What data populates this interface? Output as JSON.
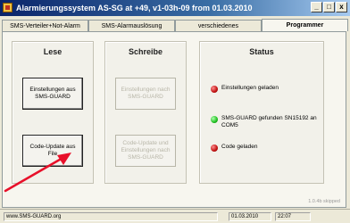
{
  "window": {
    "title": "Alarmierungssystem AS-SG at +49, v1-03h-09 from 01.03.2010",
    "minimize_label": "_",
    "maximize_label": "□",
    "close_label": "x"
  },
  "tabs": [
    {
      "label": "SMS-Verteiler+Not-Alarm"
    },
    {
      "label": "SMS-Alarmauslösung"
    },
    {
      "label": "verschiedenes"
    },
    {
      "label": "Programmer"
    }
  ],
  "groups": {
    "lese": {
      "title": "Lese",
      "btn1": "Einstellungen aus SMS-GUARD",
      "btn2": "Code-Update aus File"
    },
    "schreibe": {
      "title": "Schreibe",
      "btn1": "Einstellungen nach SMS-GUARD",
      "btn2": "Code-Update und Einstellungen nach SMS-GUARD"
    },
    "status": {
      "title": "Status",
      "items": [
        {
          "text": "Einstellungen geladen",
          "led": "red"
        },
        {
          "text": "SMS-GUARD gefunden SN15192 an COM5",
          "led": "green"
        },
        {
          "text": "Code geladen",
          "led": "red"
        }
      ]
    }
  },
  "version_text": "1.0.4b skipped",
  "statusbar": {
    "left": "www.SMS-GUARD.org",
    "date": "01.03.2010",
    "time": "22:07"
  },
  "colors": {
    "arrow": "#e8102a",
    "led_red": "#c01010",
    "led_green": "#20c020"
  }
}
